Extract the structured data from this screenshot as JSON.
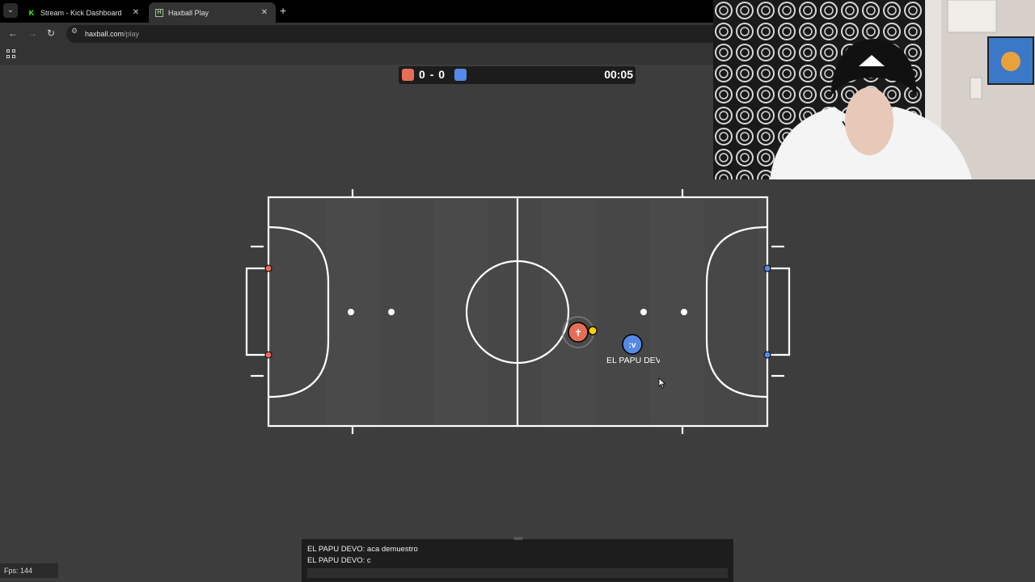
{
  "browser": {
    "tabs": [
      {
        "title": "Stream - Kick Dashboard",
        "favicon": "kick-logo-icon",
        "active": false
      },
      {
        "title": "Haxball Play",
        "favicon": "haxball-logo-icon",
        "active": true
      }
    ],
    "url_host": "haxball.com",
    "url_path": "/play"
  },
  "scoreboard": {
    "red_score": "0",
    "separator": "-",
    "blue_score": "0",
    "time": "00:05"
  },
  "colors": {
    "red_team": "#e56e56",
    "blue_team": "#5689e5",
    "ball": "#ffd000",
    "field_lines": "#ffffff"
  },
  "players": [
    {
      "team": "red",
      "avatar": "✝",
      "name": ""
    },
    {
      "team": "blue",
      "avatar": ":v",
      "name": "EL PAPU DEVO"
    }
  ],
  "fps": "Fps: 144",
  "chat": {
    "messages": [
      "EL PAPU DEVO: aca demuestro",
      "EL PAPU DEVO: c"
    ],
    "input_value": ""
  }
}
